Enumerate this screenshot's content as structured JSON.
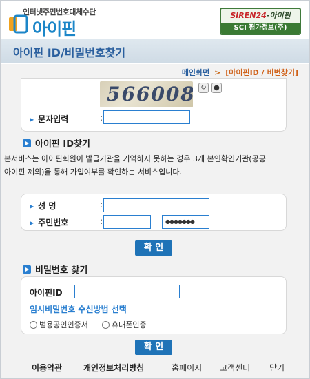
{
  "header": {
    "logo_tagline": "인터넷주민번호대체수단",
    "logo_text": "아이핀",
    "siren_brand": "SIREN24",
    "siren_suffix": "-아이핀",
    "siren_sub": "SCI 평가정보(주)"
  },
  "title": "아이핀 ID/비밀번호찾기",
  "breadcrumb": {
    "home": "메인화면",
    "separator": ">",
    "current": "[아이핀ID / 비번찾기]"
  },
  "captcha": {
    "code": "566008",
    "label": "문자입력",
    "colon": ":",
    "value": "",
    "refresh_icon": "refresh-icon",
    "audio_icon": "audio-icon"
  },
  "id_find": {
    "title": "아이핀 ID찾기",
    "description": "본서비스는 아이핀회원이 발급기관을 기억하지 못하는 경우 3개 본인확인기관(공공아이핀 제외)을 통해 가입여부를 확인하는 서비스입니다.",
    "name_label": "성 명",
    "name_value": "",
    "rrn_label": "주민번호",
    "rrn_front": "",
    "rrn_dash": "-",
    "rrn_back": "●●●●●●●",
    "confirm": "확 인"
  },
  "pw_find": {
    "title": "비밀번호 찾기",
    "id_label": "아이핀ID",
    "id_value": "",
    "method_title": "임시비밀번호 수신방법 선택",
    "option1": "범용공인인증서",
    "option2": "휴대폰인증",
    "confirm": "확 인"
  },
  "footer": {
    "terms": "이용약관",
    "privacy": "개인정보처리방침",
    "home": "홈페이지",
    "support": "고객센터",
    "close": "닫기"
  },
  "colors": {
    "accent": "#1f73b7",
    "title": "#2a5f9e",
    "crumb": "#d0621a"
  }
}
